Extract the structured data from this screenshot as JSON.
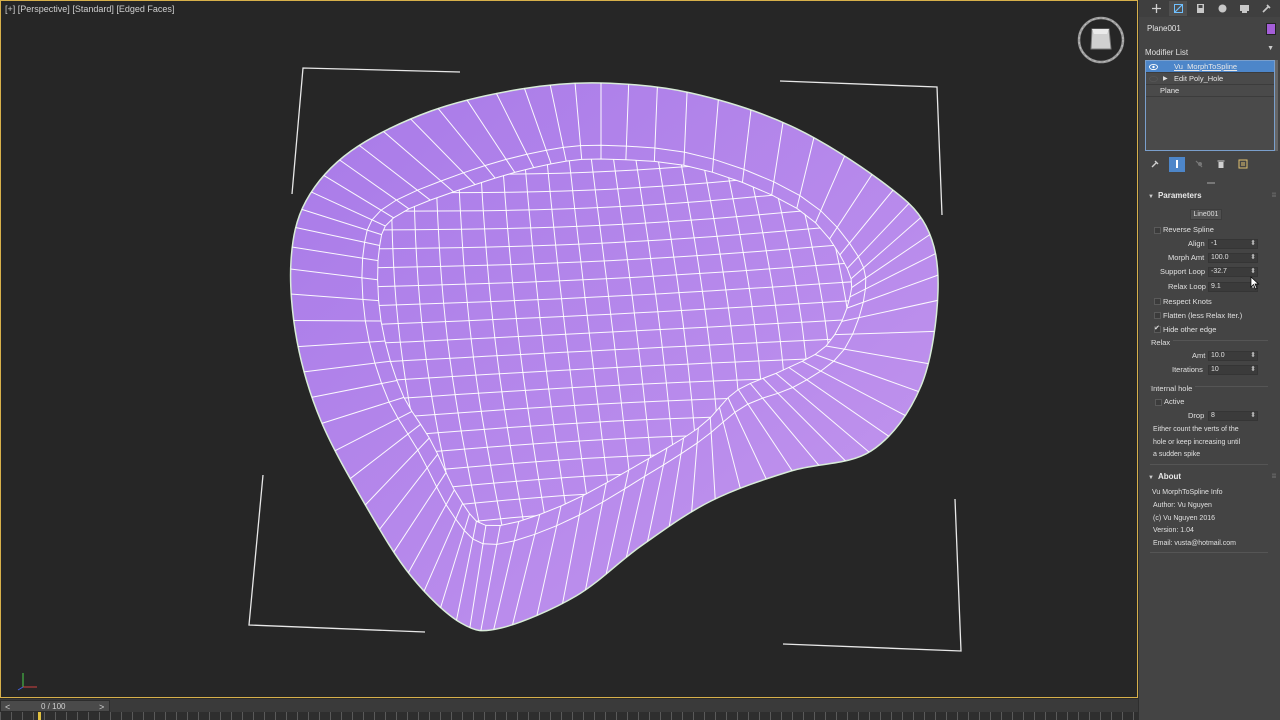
{
  "viewport": {
    "label_plus": "[+]",
    "label_view": "[Perspective]",
    "label_shading": "[Standard]",
    "label_edges": "[Edged Faces]"
  },
  "timeline": {
    "prev": "<",
    "value": "0 / 100",
    "next": ">"
  },
  "panel": {
    "tabs": [
      "create-icon",
      "modify-icon",
      "hierarchy-icon",
      "motion-icon",
      "display-icon",
      "utilities-icon"
    ],
    "object_name": "Plane001",
    "object_color": "#a45ed8",
    "modifier_list_label": "Modifier List",
    "stack": [
      {
        "label": "Vu_MorphToSpline",
        "selected": true
      },
      {
        "label": "Edit Poly_Hole",
        "selected": false
      },
      {
        "label": "Plane",
        "selected": false
      }
    ]
  },
  "parameters": {
    "title": "Parameters",
    "pick_label": "Line001",
    "reverse_spline": "Reverse Spline",
    "align_label": "Align",
    "align_value": "-1",
    "morph_label": "Morph Amt",
    "morph_value": "100.0",
    "support_label": "Support Loop",
    "support_value": "-32.7",
    "relax_loop_label": "Relax Loop",
    "relax_loop_value": "9.1",
    "respect_knots": "Respect Knots",
    "flatten": "Flatten (less Relax Iter.)",
    "hide_edge": "Hide other edge",
    "relax_group": "Relax",
    "amt_label": "Amt",
    "amt_value": "10.0",
    "iter_label": "Iterations",
    "iter_value": "10",
    "hole_group": "Internal hole",
    "active_label": "Active",
    "drop_label": "Drop",
    "drop_value": "8",
    "note_line1": "Either count the verts of the",
    "note_line2": "hole or keep increasing until",
    "note_line3": "a sudden spike"
  },
  "about": {
    "title": "About",
    "line1": "Vu MorphToSpline Info",
    "line2": "Author: Vu Nguyen",
    "line3": "(c) Vu Nguyen 2016",
    "line4": "Version: 1.04",
    "line5": "Email: vusta@hotmail.com"
  },
  "colors": {
    "mesh_fill": "#b080e4",
    "viewport_bg": "#262626",
    "selection": "#4d86c9"
  }
}
